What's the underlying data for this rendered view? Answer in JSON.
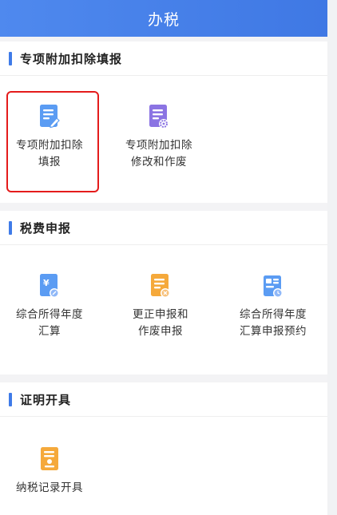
{
  "header": {
    "title": "办税"
  },
  "sections": [
    {
      "title": "专项附加扣除填报",
      "items": [
        {
          "line1": "专项附加扣除",
          "line2": "填报",
          "icon": "edit-document-icon"
        },
        {
          "line1": "专项附加扣除",
          "line2": "修改和作废",
          "icon": "document-settings-icon"
        }
      ]
    },
    {
      "title": "税费申报",
      "items": [
        {
          "line1": "综合所得年度",
          "line2": "汇算",
          "icon": "yuan-document-icon"
        },
        {
          "line1": "更正申报和",
          "line2": "作废申报",
          "icon": "document-cancel-icon"
        },
        {
          "line1": "综合所得年度",
          "line2": "汇算申报预约",
          "icon": "schedule-document-icon"
        }
      ]
    },
    {
      "title": "证明开具",
      "items": [
        {
          "line1": "纳税记录开具",
          "icon": "certificate-document-icon"
        }
      ]
    }
  ],
  "colors": {
    "header": "#4f89ee",
    "accent": "#3f7be8",
    "highlight": "#e41b1b"
  }
}
